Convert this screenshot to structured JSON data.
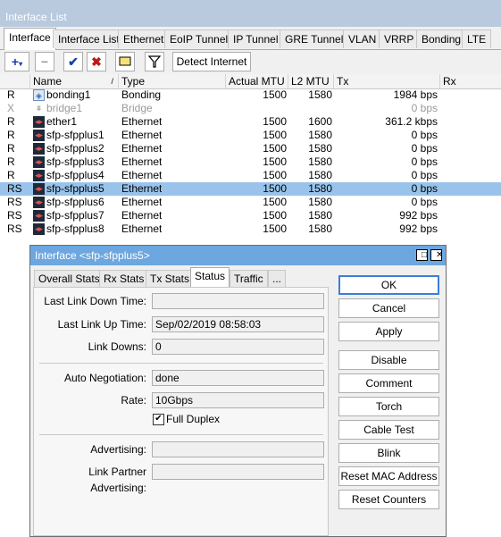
{
  "window": {
    "title": "Interface List"
  },
  "tabs": [
    "Interface",
    "Interface List",
    "Ethernet",
    "EoIP Tunnel",
    "IP Tunnel",
    "GRE Tunnel",
    "VLAN",
    "VRRP",
    "Bonding",
    "LTE"
  ],
  "toolbar": {
    "add_icon": "plus-icon",
    "remove_icon": "minus-icon",
    "enable_icon": "check-icon",
    "disable_icon": "x-icon",
    "comment_icon": "comment-icon",
    "filter_icon": "filter-icon",
    "detect_label": "Detect Internet"
  },
  "table": {
    "headers": {
      "name": "Name",
      "type": "Type",
      "actual_mtu": "Actual MTU",
      "l2_mtu": "L2 MTU",
      "tx": "Tx",
      "rx": "Rx"
    },
    "rows": [
      {
        "flags": "R",
        "name": "bonding1",
        "type": "Bonding",
        "actual_mtu": "1500",
        "l2_mtu": "1580",
        "tx": "1984 bps"
      },
      {
        "flags": "X",
        "name": "bridge1",
        "type": "Bridge",
        "actual_mtu": "",
        "l2_mtu": "",
        "tx": "0 bps"
      },
      {
        "flags": "R",
        "name": "ether1",
        "type": "Ethernet",
        "actual_mtu": "1500",
        "l2_mtu": "1600",
        "tx": "361.2 kbps"
      },
      {
        "flags": "R",
        "name": "sfp-sfpplus1",
        "type": "Ethernet",
        "actual_mtu": "1500",
        "l2_mtu": "1580",
        "tx": "0 bps"
      },
      {
        "flags": "R",
        "name": "sfp-sfpplus2",
        "type": "Ethernet",
        "actual_mtu": "1500",
        "l2_mtu": "1580",
        "tx": "0 bps"
      },
      {
        "flags": "R",
        "name": "sfp-sfpplus3",
        "type": "Ethernet",
        "actual_mtu": "1500",
        "l2_mtu": "1580",
        "tx": "0 bps"
      },
      {
        "flags": "R",
        "name": "sfp-sfpplus4",
        "type": "Ethernet",
        "actual_mtu": "1500",
        "l2_mtu": "1580",
        "tx": "0 bps"
      },
      {
        "flags": "RS",
        "name": "sfp-sfpplus5",
        "type": "Ethernet",
        "actual_mtu": "1500",
        "l2_mtu": "1580",
        "tx": "0 bps"
      },
      {
        "flags": "RS",
        "name": "sfp-sfpplus6",
        "type": "Ethernet",
        "actual_mtu": "1500",
        "l2_mtu": "1580",
        "tx": "0 bps"
      },
      {
        "flags": "RS",
        "name": "sfp-sfpplus7",
        "type": "Ethernet",
        "actual_mtu": "1500",
        "l2_mtu": "1580",
        "tx": "992 bps"
      },
      {
        "flags": "RS",
        "name": "sfp-sfpplus8",
        "type": "Ethernet",
        "actual_mtu": "1500",
        "l2_mtu": "1580",
        "tx": "992 bps"
      }
    ]
  },
  "dialog": {
    "title": "Interface <sfp-sfpplus5>",
    "tabs": [
      "Overall Stats",
      "Rx Stats",
      "Tx Stats",
      "Status",
      "Traffic",
      "..."
    ],
    "fields": {
      "last_link_down_label": "Last Link Down Time:",
      "last_link_down_value": "",
      "last_link_up_label": "Last Link Up Time:",
      "last_link_up_value": "Sep/02/2019 08:58:03",
      "link_downs_label": "Link Downs:",
      "link_downs_value": "0",
      "auto_neg_label": "Auto Negotiation:",
      "auto_neg_value": "done",
      "rate_label": "Rate:",
      "rate_value": "10Gbps",
      "full_duplex_label": "Full Duplex",
      "advertising_label": "Advertising:",
      "advertising_value": "",
      "partner_adv_label": "Link Partner Advertising:",
      "partner_adv_value": ""
    },
    "buttons": [
      "OK",
      "Cancel",
      "Apply",
      "Disable",
      "Comment",
      "Torch",
      "Cable Test",
      "Blink",
      "Reset MAC Address",
      "Reset Counters"
    ]
  }
}
